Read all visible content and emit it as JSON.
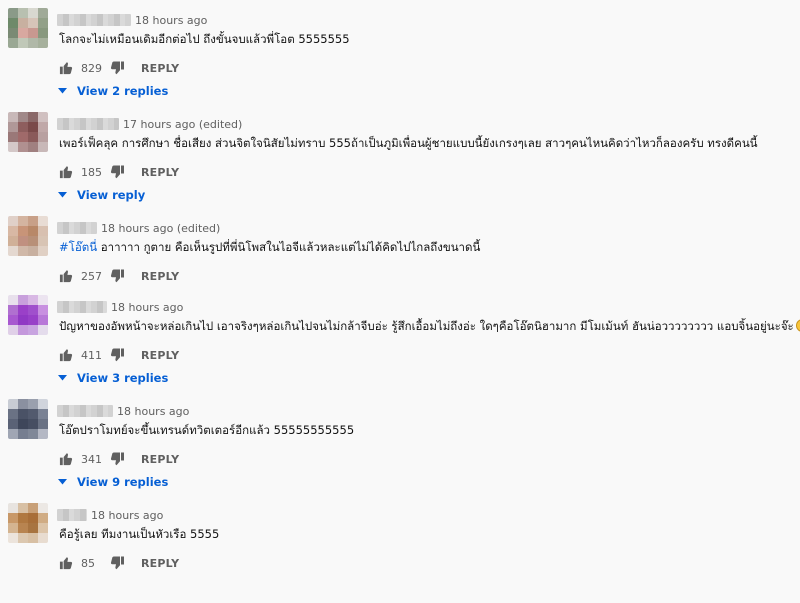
{
  "comments": [
    {
      "time": "18 hours ago",
      "text": "โลกจะไม่เหมือนเดิมอีกต่อไป ถึงขั้นจบแล้วพี่โอต 5555555",
      "likes": "829",
      "reply_label": "REPLY",
      "view_replies": "View 2 replies",
      "avatar_colors": [
        "#8a9a88",
        "#b8c0b0",
        "#d8d8d0",
        "#a0aa98",
        "#6e8a6a",
        "#c8b0a0",
        "#d6c4b8",
        "#92a088",
        "#7a8a74",
        "#d8a8a0",
        "#c89890",
        "#88987e",
        "#9aa894",
        "#c0c8b8",
        "#b0b8a8",
        "#a6b09c"
      ]
    },
    {
      "time": "17 hours ago (edited)",
      "text": "เพอร์เฟ็คลุค การศึกษา ชื่อเสียง ส่วนจิตใจนิสัยไม่ทราบ 555ถ้าเป็นภูมิเพื่อนผู้ชายแบบนี้ยังเกรงๆเลย สาวๆคนไหนคิดว่าไหวก็ลองครับ ทรงดีคนนี้",
      "likes": "185",
      "reply_label": "REPLY",
      "view_replies": "View reply",
      "avatar_colors": [
        "#c8b8b8",
        "#a08888",
        "#8a6868",
        "#d0c0c0",
        "#b09898",
        "#8e5e5e",
        "#7a4a4a",
        "#c0a8a8",
        "#9a7878",
        "#a06a6a",
        "#8a5a5a",
        "#b8a0a0",
        "#d4c8c8",
        "#b09090",
        "#a08080",
        "#c8b8b8"
      ]
    },
    {
      "time": "18 hours ago (edited)",
      "text_tag": "#โอ๊ตนี่",
      "text": " อาาาาา กูตาย คือเห็นรูปที่พี่นิโพสในไอจีแล้วหละแต่ไม่ได้คิดไปไกลถึงขนาดนี้",
      "likes": "257",
      "reply_label": "REPLY",
      "view_replies": "",
      "avatar_colors": [
        "#e0d0c8",
        "#d4b4a0",
        "#c8a088",
        "#e8dcd4",
        "#d8b8a4",
        "#c89478",
        "#b88868",
        "#d8c0b0",
        "#d0b098",
        "#c09080",
        "#b89078",
        "#d8c4b4",
        "#e4d8d0",
        "#d0b8a8",
        "#c8b0a0",
        "#e0d0c4"
      ]
    },
    {
      "time": "18 hours ago",
      "text": "ปัญหาของอัพหน้าจะหล่อเกินไป เอาจริงๆหล่อเกินไปจนไม่กล้าจีบอ่ะ รู้สึกเอื้อมไม่ถึงอ่ะ ใดๆคือโอ๊ตนิฮามาก มีโมเม้นท์ ฮันน่อวววววววว แอบจิ้นอยู่นะจ๊ะ",
      "likes": "411",
      "reply_label": "REPLY",
      "view_replies": "View 3 replies",
      "avatar_colors": [
        "#e8e0ec",
        "#c8a0dc",
        "#d8b8e4",
        "#ece4f0",
        "#b070d0",
        "#9a40c8",
        "#a050cc",
        "#c890e0",
        "#a858d0",
        "#9038c4",
        "#9840c8",
        "#b878d8",
        "#e0d0e8",
        "#c498dc",
        "#c8a4e0",
        "#e4dcec"
      ]
    },
    {
      "time": "18 hours ago",
      "text": "โอ๊ตปราโมทย์จะขึ้นเทรนด์ทวิตเตอร์อีกแล้ว 55555555555",
      "likes": "341",
      "reply_label": "REPLY",
      "view_replies": "View 9 replies",
      "avatar_colors": [
        "#c8ccd4",
        "#8a90a0",
        "#9aa0ae",
        "#d0d4dc",
        "#6a7284",
        "#4a5266",
        "#525a6e",
        "#7a8294",
        "#5a6276",
        "#3e465a",
        "#464e62",
        "#6a7284",
        "#a0a6b4",
        "#767e90",
        "#808898",
        "#b4b8c4"
      ]
    },
    {
      "time": "18 hours ago",
      "text": "คือรู้เลย ทีมงานเป็นหัวเรือ 5555",
      "likes": "85",
      "reply_label": "REPLY",
      "view_replies": "",
      "avatar_colors": [
        "#e8e4e0",
        "#d8c0a4",
        "#c8a078",
        "#ece8e4",
        "#c89868",
        "#b07840",
        "#a86e38",
        "#d0ac84",
        "#d4b490",
        "#b88450",
        "#a87440",
        "#dcc4a8",
        "#ece4dc",
        "#dcc8b0",
        "#d8c0a4",
        "#e8dcd0"
      ]
    }
  ],
  "emoji_count": 3
}
